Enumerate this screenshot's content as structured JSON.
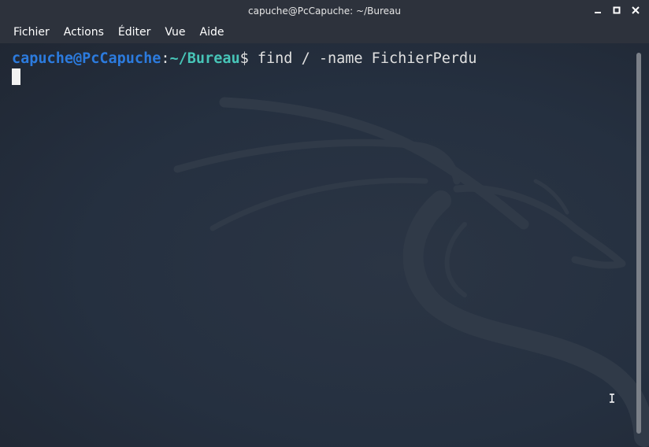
{
  "window": {
    "title": "capuche@PcCapuche: ~/Bureau"
  },
  "window_controls": {
    "minimize_icon": "minimize-icon",
    "maximize_icon": "maximize-icon",
    "close_icon": "close-icon"
  },
  "menu": {
    "items": [
      {
        "label": "Fichier"
      },
      {
        "label": "Actions"
      },
      {
        "label": "Éditer"
      },
      {
        "label": "Vue"
      },
      {
        "label": "Aide"
      }
    ]
  },
  "terminal": {
    "prompt_user": "capuche@PcCapuche",
    "prompt_colon": ":",
    "prompt_path": "~/Bureau",
    "prompt_symbol": "$",
    "command": " find / -name FichierPerdu",
    "colors": {
      "user": "#2c7bde",
      "path": "#47c5b8",
      "text": "#e0e0e0",
      "background": "#263040"
    }
  },
  "background_logo": "dragon-logo"
}
